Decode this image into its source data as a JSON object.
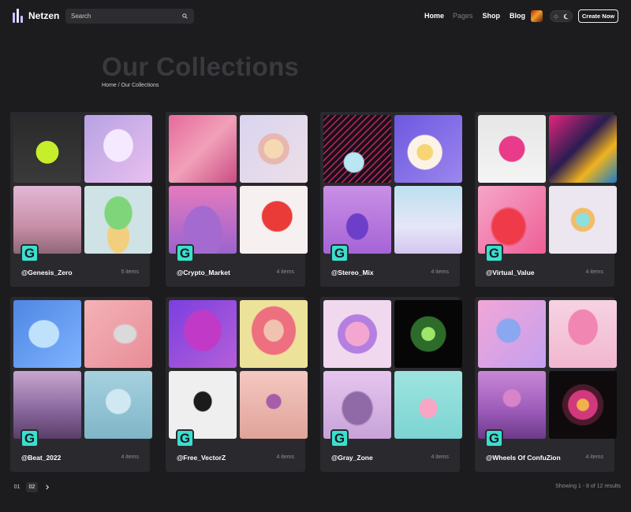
{
  "header": {
    "brand": "Netzen",
    "search_placeholder": "Search",
    "nav": [
      {
        "label": "Home",
        "active": true
      },
      {
        "label": "Pages",
        "active": false
      },
      {
        "label": "Shop",
        "active": true
      },
      {
        "label": "Blog",
        "active": true
      }
    ],
    "create_label": "Create Now"
  },
  "page": {
    "title": "Our Collections",
    "breadcrumb": "Home / Our Collections"
  },
  "collections": [
    {
      "name": "@Genesis_Zero",
      "count": "5 items",
      "badge": "G"
    },
    {
      "name": "@Crypto_Market",
      "count": "4 items",
      "badge": "G"
    },
    {
      "name": "@Stereo_Mix",
      "count": "4 items",
      "badge": "G"
    },
    {
      "name": "@Virtual_Value",
      "count": "4 items",
      "badge": "G"
    },
    {
      "name": "@Beat_2022",
      "count": "4 items",
      "badge": "G"
    },
    {
      "name": "@Free_VectorZ",
      "count": "4 items",
      "badge": "G"
    },
    {
      "name": "@Gray_Zone",
      "count": "4 items",
      "badge": "G"
    },
    {
      "name": "@Wheels Of ConfuZion",
      "count": "4 items",
      "badge": "G"
    }
  ],
  "pagination": {
    "pages": [
      "01",
      "02"
    ],
    "current": "02"
  },
  "results_text": "Showing 1 - 8 of 12 results",
  "colors": {
    "background": "#1c1c1f",
    "card": "#2a2a2e",
    "badge": "#39e0cf"
  }
}
